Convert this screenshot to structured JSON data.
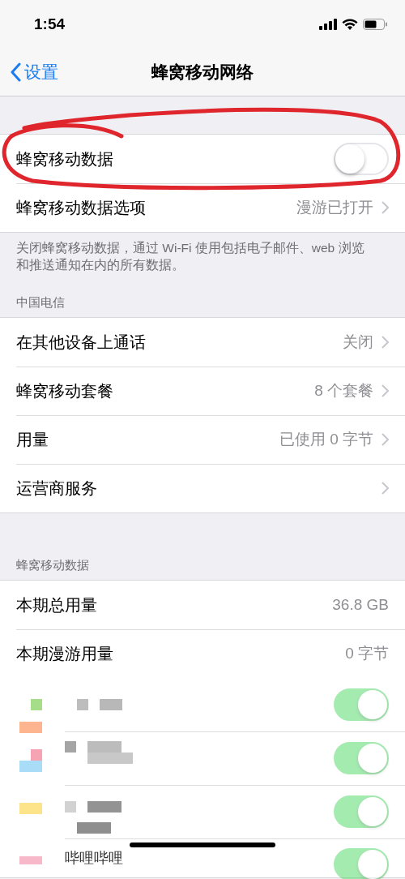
{
  "status_bar": {
    "time": "1:54"
  },
  "nav": {
    "back": "设置",
    "title": "蜂窝移动网络"
  },
  "main_group": [
    {
      "kind": "toggle",
      "label": "蜂窝移动数据",
      "on": false
    },
    {
      "kind": "link",
      "label": "蜂窝移动数据选项",
      "value": "漫游已打开"
    }
  ],
  "main_footer": "关闭蜂窝移动数据，通过 Wi-Fi 使用包括电子邮件、web 浏览和推送通知在内的所有数据。",
  "carrier_header": "中国电信",
  "carrier_group": [
    {
      "label": "在其他设备上通话",
      "value": "关闭"
    },
    {
      "label": "蜂窝移动套餐",
      "value": "8 个套餐"
    },
    {
      "label": "用量",
      "value": "已使用 0 字节"
    },
    {
      "label": "运营商服务"
    }
  ],
  "data_header": "蜂窝移动数据",
  "usage": [
    {
      "label": "本期总用量",
      "value": "36.8 GB"
    },
    {
      "label": "本期漫游用量",
      "value": "0 字节"
    }
  ],
  "apps": [
    {
      "on": true,
      "disabled": true
    },
    {
      "on": true,
      "disabled": true
    },
    {
      "on": true,
      "disabled": true
    },
    {
      "name": "哔哩哔哩",
      "on": true,
      "disabled": true
    }
  ]
}
